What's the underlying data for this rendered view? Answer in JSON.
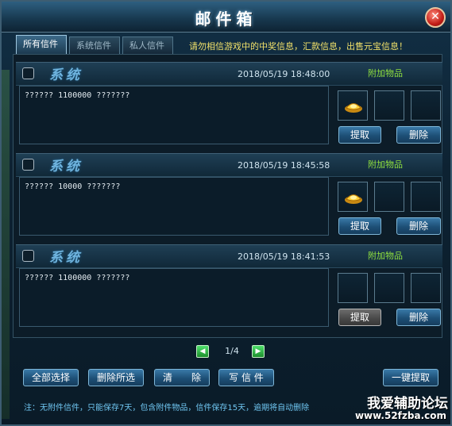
{
  "window": {
    "title": "邮件箱",
    "close_symbol": "✕"
  },
  "tabs": [
    {
      "label": "所有信件",
      "active": true
    },
    {
      "label": "系统信件",
      "active": false
    },
    {
      "label": "私人信件",
      "active": false
    }
  ],
  "warning": "请勿相信游戏中的中奖信息，汇款信息，出售元宝信息！",
  "mails": [
    {
      "sender": "系统",
      "time": "2018/05/19 18:48:00",
      "attachment_label": "附加物品",
      "body": "?????? 1100000 ???????",
      "has_gold": true,
      "extract_label": "提取",
      "extract_enabled": true,
      "delete_label": "删除"
    },
    {
      "sender": "系统",
      "time": "2018/05/19 18:45:58",
      "attachment_label": "附加物品",
      "body": "?????? 10000 ???????",
      "has_gold": true,
      "extract_label": "提取",
      "extract_enabled": true,
      "delete_label": "删除"
    },
    {
      "sender": "系统",
      "time": "2018/05/19 18:41:53",
      "attachment_label": "附加物品",
      "body": "?????? 1100000 ???????",
      "has_gold": false,
      "extract_label": "提取",
      "extract_enabled": false,
      "delete_label": "删除"
    }
  ],
  "pager": {
    "label": "1/4",
    "prev_symbol": "◀",
    "next_symbol": "▶"
  },
  "actions": {
    "select_all": "全部选择",
    "delete_selected": "删除所选",
    "clear": "清　　除",
    "write": "写 信 件",
    "one_click_extract": "一键提取"
  },
  "note": "注：无附件信件，只能保存7天，包含附件物品，信件保存15天，逾期将自动删除",
  "watermark": {
    "line1": "我爱辅助论坛",
    "line2": "www.52fzba.com"
  }
}
